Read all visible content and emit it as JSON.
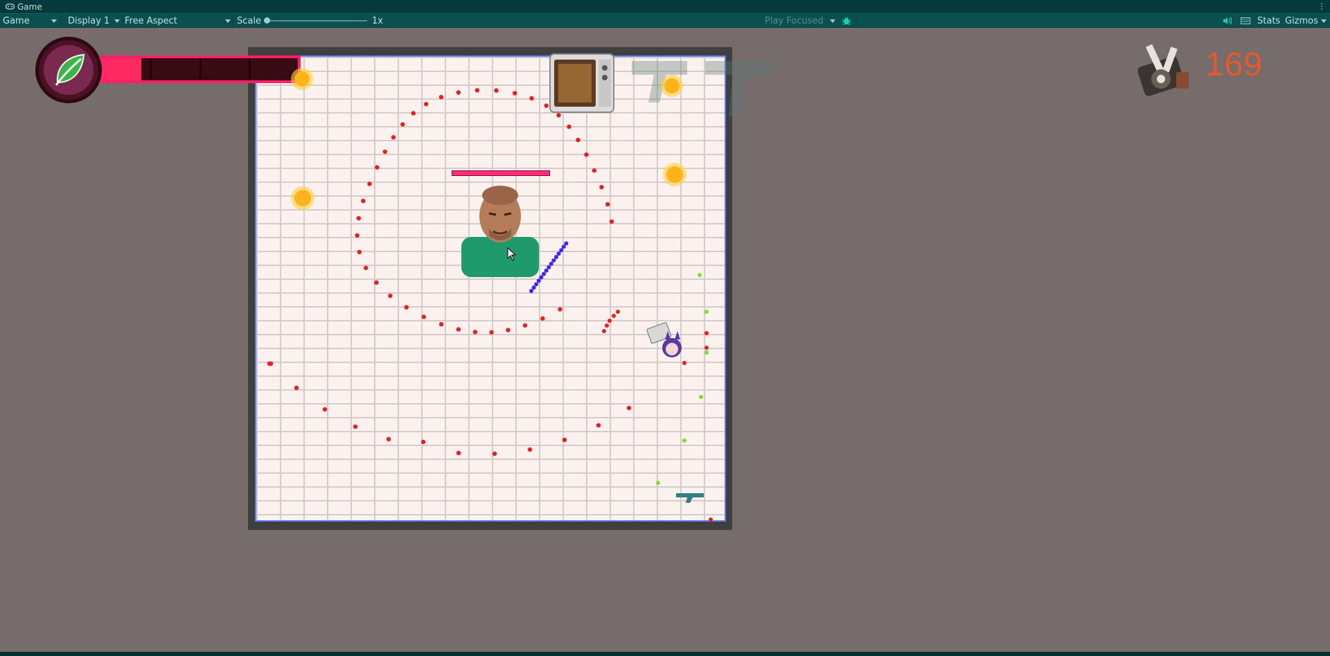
{
  "window": {
    "title": "Game"
  },
  "toolbar": {
    "view_label": "Game",
    "display_label": "Display 1",
    "aspect_label": "Free Aspect",
    "scale_label": "Scale",
    "scale_value": "1x",
    "play_mode_label": "Play Focused",
    "stats_label": "Stats",
    "gizmos_label": "Gizmos"
  },
  "hud": {
    "score": "169",
    "health_fraction": 0.2,
    "health_segments": 4
  },
  "colors": {
    "accent": "#0b5050",
    "health": "#ff2a62",
    "score": "#e8582a",
    "enemy_bullet": "#ee1c1c",
    "player_bullet": "#3a24ff",
    "pickup": "#7be02a"
  },
  "icons": [
    "gamepad-icon",
    "leaf-icon",
    "microwave-icon",
    "turret-icon",
    "sun-icon",
    "gun-icon",
    "audio-icon",
    "keyboard-icon",
    "bug-icon"
  ]
}
